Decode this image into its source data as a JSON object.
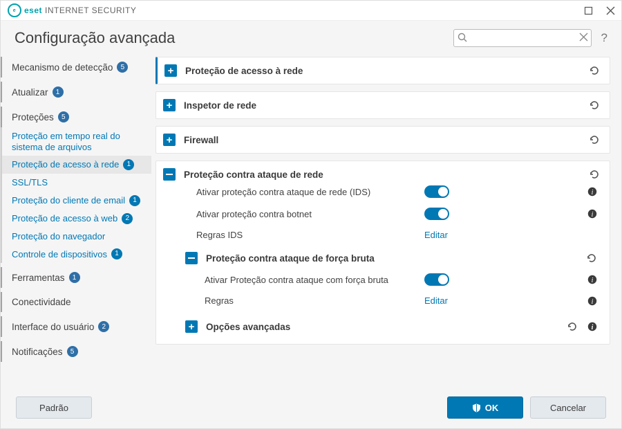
{
  "titlebar": {
    "brand": "eset",
    "product": "INTERNET SECURITY"
  },
  "header": {
    "title": "Configuração avançada",
    "search_placeholder": ""
  },
  "sidebar": [
    {
      "type": "top",
      "label": "Mecanismo de detecção",
      "badge": "5"
    },
    {
      "type": "top",
      "label": "Atualizar",
      "badge": "1"
    },
    {
      "type": "top",
      "label": "Proteções",
      "badge": "5"
    },
    {
      "type": "sub",
      "label": "Proteção em tempo real do sistema de arquivos"
    },
    {
      "type": "sub",
      "label": "Proteção de acesso à rede",
      "badge": "1",
      "active": true
    },
    {
      "type": "sub",
      "label": "SSL/TLS"
    },
    {
      "type": "sub",
      "label": "Proteção do cliente de email",
      "badge": "1"
    },
    {
      "type": "sub",
      "label": "Proteção de acesso à web",
      "badge": "2"
    },
    {
      "type": "sub",
      "label": "Proteção do navegador"
    },
    {
      "type": "sub",
      "label": "Controle de dispositivos",
      "badge": "1"
    },
    {
      "type": "top",
      "label": "Ferramentas",
      "badge": "1"
    },
    {
      "type": "top",
      "label": "Conectividade"
    },
    {
      "type": "top",
      "label": "Interface do usuário",
      "badge": "2"
    },
    {
      "type": "top",
      "label": "Notificações",
      "badge": "5"
    }
  ],
  "panels": {
    "p1": "Proteção de acesso à rede",
    "p2": "Inspetor de rede",
    "p3": "Firewall",
    "p4": {
      "title": "Proteção contra ataque de rede",
      "r1": "Ativar proteção contra ataque de rede (IDS)",
      "r2": "Ativar proteção contra botnet",
      "r3": "Regras IDS",
      "r3_link": "Editar",
      "sub": {
        "title": "Proteção contra ataque de força bruta",
        "r1": "Ativar Proteção contra ataque com força bruta",
        "r2": "Regras",
        "r2_link": "Editar"
      },
      "adv": "Opções avançadas"
    }
  },
  "footer": {
    "default": "Padrão",
    "ok": "OK",
    "cancel": "Cancelar"
  }
}
